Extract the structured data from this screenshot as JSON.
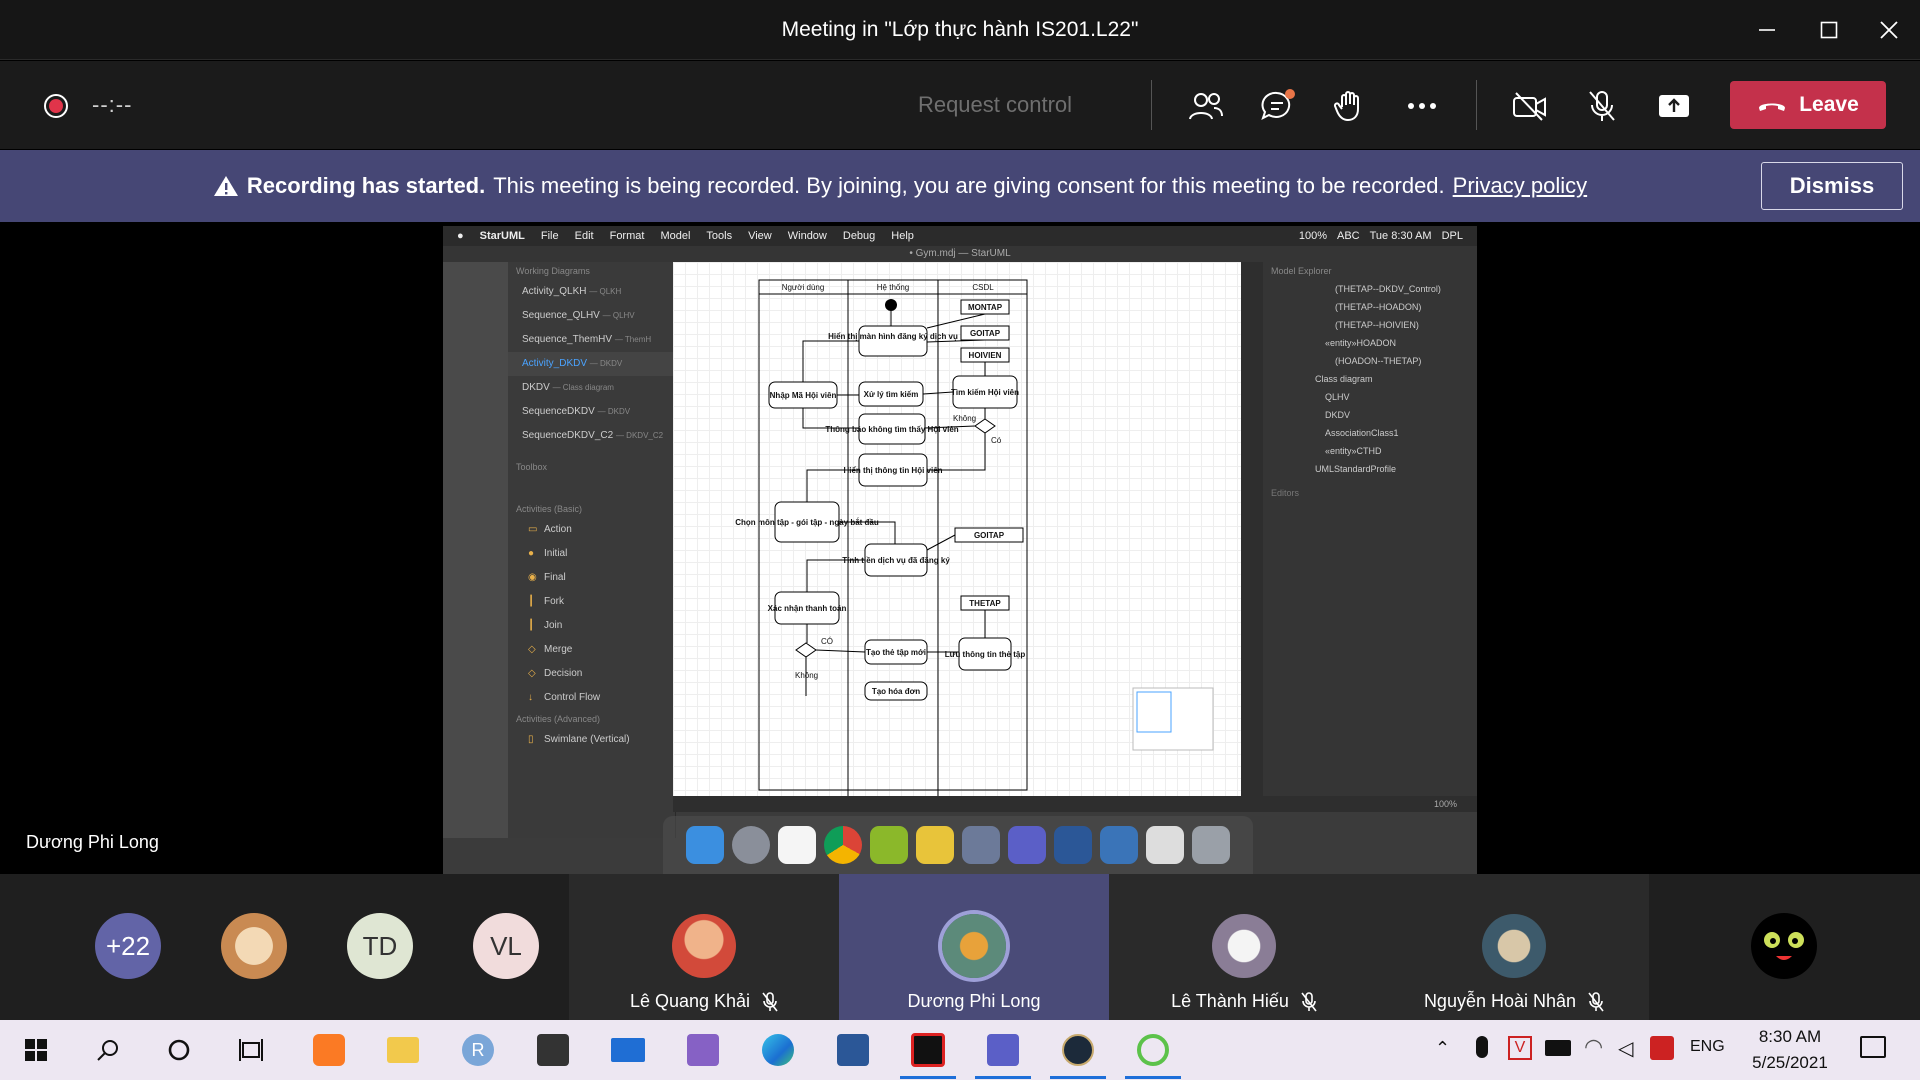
{
  "window": {
    "title": "Meeting in \"Lớp thực hành IS201.L22\""
  },
  "toolbar": {
    "timer": "--:--",
    "request_control": "Request control",
    "leave_label": "Leave"
  },
  "banner": {
    "bold": "Recording has started.",
    "text": "This meeting is being recorded. By joining, you are giving consent for this meeting to be recorded.",
    "link": "Privacy policy",
    "dismiss": "Dismiss"
  },
  "presenter": {
    "name": "Dương Phi Long"
  },
  "shared_screen": {
    "menubar": {
      "app": "StarUML",
      "items": [
        "File",
        "Edit",
        "Format",
        "Model",
        "Tools",
        "View",
        "Window",
        "Debug",
        "Help"
      ],
      "battery": "100%",
      "input": "ABC",
      "clock": "Tue 8:30 AM",
      "user": "DPL"
    },
    "window_title": "• Gym.mdj — StarUML",
    "sidebar": {
      "working_header": "Working Diagrams",
      "items": [
        {
          "name": "Activity_QLKH",
          "sub": "— QLKH"
        },
        {
          "name": "Sequence_QLHV",
          "sub": "— QLHV"
        },
        {
          "name": "Sequence_ThemHV",
          "sub": "— ThemH"
        },
        {
          "name": "Activity_DKDV",
          "sub": "— DKDV"
        },
        {
          "name": "DKDV",
          "sub": "— Class diagram"
        },
        {
          "name": "SequenceDKDV",
          "sub": "— DKDV"
        },
        {
          "name": "SequenceDKDV_C2",
          "sub": "— DKDV_C2"
        }
      ],
      "toolbox_header": "Toolbox",
      "basic_header": "Activities (Basic)",
      "tools": [
        "Action",
        "Initial",
        "Final",
        "Fork",
        "Join",
        "Merge",
        "Decision",
        "Control Flow"
      ],
      "advanced_header": "Activities (Advanced)",
      "advanced_tools": [
        "Swimlane (Vertical)"
      ]
    },
    "explorer": {
      "header": "Model Explorer",
      "items": [
        "(THETAP--DKDV_Control)",
        "(THETAP--HOADON)",
        "(THETAP--HOIVIEN)",
        "«entity»HOADON",
        "(HOADON--THETAP)",
        "Class diagram",
        "QLHV",
        "DKDV",
        "AssociationClass1",
        "«entity»CTHD",
        "UMLStandardProfile"
      ],
      "editors": "Editors"
    },
    "zoom": "100%",
    "diagram": {
      "lanes": [
        "Người dùng",
        "Hệ thống",
        "CSDL"
      ],
      "actions": [
        "Hiển thị màn hình đăng ký dịch vụ",
        "Nhập Mã Hội viên",
        "Xử lý tìm kiếm",
        "Tìm kiếm Hội viên",
        "Thông báo không tìm thấy Hội viên",
        "Hiển thị thông tin Hội viên",
        "Chọn môn tập - gói tập - ngày bắt đầu",
        "Tính tiền dịch vụ đã đăng ký",
        "Xác nhận thanh toán",
        "Tạo thẻ tập mới",
        "Lưu thông tin thẻ tập",
        "Tạo hóa đơn"
      ],
      "objects": [
        "MONTAP",
        "GOITAP",
        "HOIVIEN",
        "GOITAP",
        "THETAP"
      ],
      "guards": [
        "Không",
        "Có",
        "CÓ",
        "Không"
      ]
    }
  },
  "participants": {
    "overflow": "+22",
    "initials": [
      "TD",
      "VL"
    ],
    "tiles": [
      {
        "name": "Lê Quang Khải",
        "muted": true
      },
      {
        "name": "Dương Phi Long",
        "muted": false
      },
      {
        "name": "Lê Thành Hiếu",
        "muted": true
      },
      {
        "name": "Nguyễn Hoài Nhân",
        "muted": true
      }
    ]
  },
  "taskbar": {
    "lang": "ENG",
    "time": "8:30 AM",
    "date": "5/25/2021"
  },
  "colors": {
    "leave": "#c4314b",
    "banner": "#464775",
    "accent": "#6264a7"
  }
}
